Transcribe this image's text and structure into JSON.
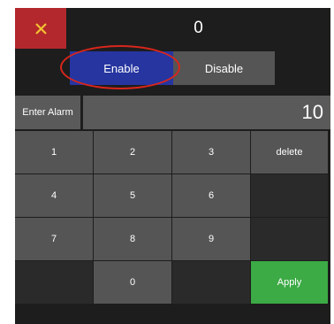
{
  "header": {
    "close_icon": "close-icon",
    "value": "0"
  },
  "toggle": {
    "enable_label": "Enable",
    "disable_label": "Disable"
  },
  "alarm": {
    "label": "Enter Alarm",
    "value": "10"
  },
  "keypad": {
    "k1": "1",
    "k2": "2",
    "k3": "3",
    "delete": "delete",
    "k4": "4",
    "k5": "5",
    "k6": "6",
    "k7": "7",
    "k8": "8",
    "k9": "9",
    "k0": "0",
    "apply": "Apply"
  },
  "colors": {
    "close_bg": "#b3282d",
    "enable_bg": "#2635a0",
    "key_bg": "#555555",
    "apply_bg": "#3caa45",
    "panel_bg": "#1d1d1d",
    "highlight": "#d9261c"
  }
}
